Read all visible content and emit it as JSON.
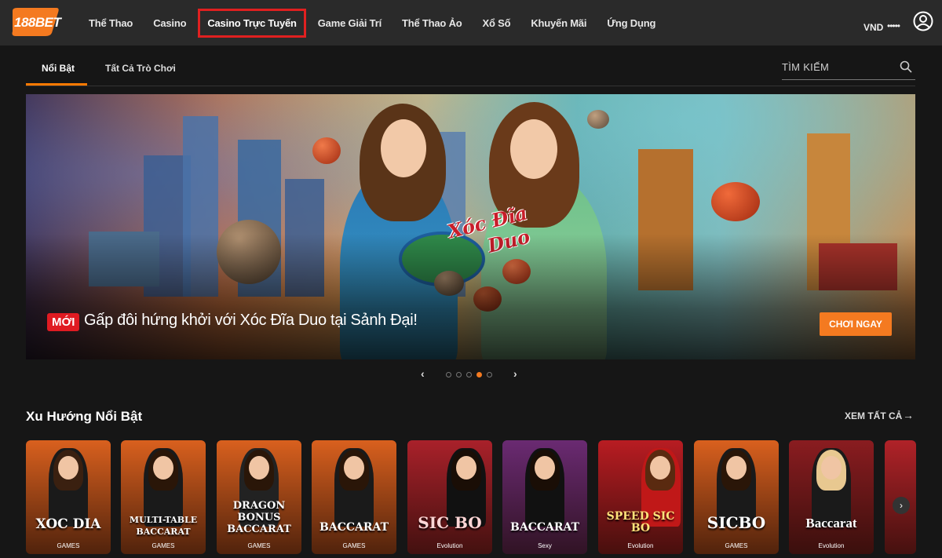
{
  "header": {
    "logo_num": "188",
    "logo_bet": "BET",
    "nav": [
      {
        "label": "Thể Thao"
      },
      {
        "label": "Casino"
      },
      {
        "label": "Casino Trực Tuyến"
      },
      {
        "label": "Game Giải Trí"
      },
      {
        "label": "Thể Thao Ảo"
      },
      {
        "label": "Xổ Số"
      },
      {
        "label": "Khuyến Mãi"
      },
      {
        "label": "Ứng Dụng"
      }
    ],
    "currency": "VND",
    "balance_masked": "•••••"
  },
  "tabs": [
    {
      "label": "Nổi Bật"
    },
    {
      "label": "Tất Cả Trò Chơi"
    }
  ],
  "search": {
    "placeholder": "TÌM KIẾM"
  },
  "banner": {
    "game_title_line1": "Xóc Đĩa",
    "game_title_line2": "Duo",
    "badge": "MỚI",
    "promo_text": "Gấp đôi hứng khởi với Xóc Đĩa Duo tại Sảnh Đại!",
    "cta": "CHƠI NGAY",
    "slides_total": 5,
    "active_slide": 4
  },
  "trending": {
    "title": "Xu Hướng Nổi Bật",
    "see_all": "XEM TẤT CẢ",
    "cards": [
      {
        "title": "XOC DIA",
        "sub": "GAMES",
        "color": "#d9601e"
      },
      {
        "title": "MULTI-TABLE BACCARAT",
        "sub": "GAMES",
        "color": "#d9601e"
      },
      {
        "title": "DRAGON BONUS BACCARAT",
        "sub": "GAMES",
        "color": "#d9601e"
      },
      {
        "title": "BACCARAT",
        "sub": "GAMES",
        "color": "#d9601e"
      },
      {
        "title": "SIC BO",
        "sub": "Evolution",
        "color": "#a9212a"
      },
      {
        "title": "BACCARAT",
        "sub": "Sexy",
        "color": "#6a2a72"
      },
      {
        "title": "SPEED SIC BO",
        "sub": "Evolution",
        "color": "#b81c22"
      },
      {
        "title": "SICBO",
        "sub": "GAMES",
        "color": "#d9601e"
      },
      {
        "title": "Baccarat",
        "sub": "Evolution",
        "color": "#8a1c20"
      },
      {
        "title": "",
        "sub": "",
        "color": "#b02228"
      }
    ]
  },
  "colors": {
    "accent": "#f47a20",
    "highlight_box": "#e02020",
    "badge": "#e01b22"
  }
}
